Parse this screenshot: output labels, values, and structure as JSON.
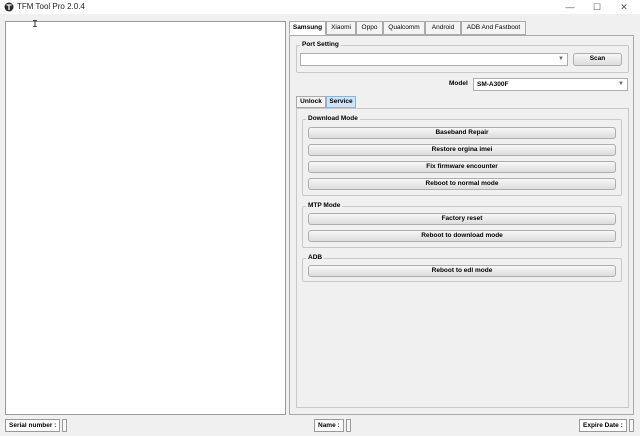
{
  "window": {
    "title": "TFM Tool Pro 2.0.4"
  },
  "tabs": [
    "Samsung",
    "Xiaomi",
    "Oppo",
    "Qualcomm",
    "Android",
    "ADB And Fastboot"
  ],
  "port": {
    "label": "Port Setting",
    "value": "",
    "scan_label": "Scan"
  },
  "model": {
    "label": "Model",
    "value": "SM-A300F"
  },
  "subtabs": [
    "Unlock",
    "Service"
  ],
  "groups": {
    "download_mode": {
      "label": "Download Mode",
      "buttons": [
        "Baseband Repair",
        "Restore orgina imei",
        "Fix firmware encounter",
        "Reboot to normal mode"
      ]
    },
    "mtp_mode": {
      "label": "MTP Mode",
      "buttons": [
        "Factory reset",
        "Reboot to download mode"
      ]
    },
    "adb": {
      "label": "ADB",
      "buttons": [
        "Reboot to edl mode"
      ]
    }
  },
  "status": {
    "serial_label": "Serial number :",
    "name_label": "Name :",
    "expire_label": "Expire Date :"
  }
}
